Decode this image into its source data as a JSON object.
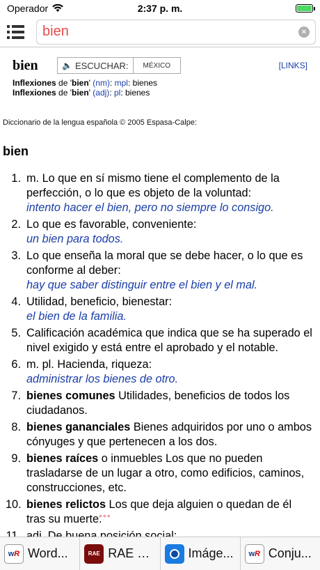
{
  "status": {
    "carrier": "Operador",
    "time": "2:37 p. m.",
    "battery_level": 1.0
  },
  "search": {
    "value": "bien",
    "clear_label": "×"
  },
  "entry": {
    "headword": "bien",
    "listen_label": "ESCUCHAR:",
    "region_label": "MÉXICO",
    "links_label": "[LINKS]",
    "inflections": [
      {
        "prefix": "Inflexiones",
        "mid": " de '",
        "word": "bien",
        "close": "' ",
        "pos": "(nm)",
        "sep": ": ",
        "form": "mpl",
        "rest": ": bienes"
      },
      {
        "prefix": "Inflexiones",
        "mid": " de '",
        "word": "bien",
        "close": "' ",
        "pos": "(adj)",
        "sep": ": ",
        "form": "pl",
        "rest": ": bienes"
      }
    ],
    "source": "Diccionario de la lengua española © 2005 Espasa-Calpe:",
    "def_title": "bien"
  },
  "definitions": [
    {
      "num": "1.",
      "bold": "",
      "text": "m. Lo que en sí mismo tiene el complemento de la perfección, o lo que es objeto de la voluntad:",
      "example": "intento hacer el bien, pero no siempre lo consigo."
    },
    {
      "num": "2.",
      "bold": "",
      "text": "Lo que es favorable, conveniente:",
      "example": "un bien para todos."
    },
    {
      "num": "3.",
      "bold": "",
      "text": "Lo que enseña la moral que se debe hacer, o lo que es conforme al deber:",
      "example": "hay que saber distinguir entre el bien y el mal."
    },
    {
      "num": "4.",
      "bold": "",
      "text": "Utilidad, beneficio, bienestar:",
      "example": "el bien de la familia."
    },
    {
      "num": "5.",
      "bold": "",
      "text": "Calificación académica que indica que se ha superado el nivel exigido y está entre el aprobado y el notable.",
      "example": ""
    },
    {
      "num": "6.",
      "bold": "",
      "text": "m. pl. Hacienda, riqueza:",
      "example": "administrar los bienes de otro."
    },
    {
      "num": "7.",
      "bold": "bienes comunes",
      "text": " Utilidades, beneficios de todos los ciudadanos.",
      "example": ""
    },
    {
      "num": "8.",
      "bold": "bienes gananciales",
      "text": " Bienes adquiridos por uno o ambos cónyuges y que pertenecen a los dos.",
      "example": ""
    },
    {
      "num": "9.",
      "bold": "bienes raíces",
      "text": " o inmuebles Los que no pueden trasladarse de un lugar a otro, como edificios, caminos, construcciones, etc.",
      "example": ""
    },
    {
      "num": "10.",
      "bold": "bienes relictos",
      "text": " Los que deja alguien o quedan de él tras su muerte.",
      "example": ""
    },
    {
      "num": "11.",
      "bold": "",
      "text": "adj. De buena posición social:",
      "example": ""
    }
  ],
  "loading_indicator": "•••",
  "tabs": [
    {
      "label": "Word...",
      "icon": "wordreference-icon"
    },
    {
      "label": "RAE B...",
      "icon": "rae-book-icon"
    },
    {
      "label": "Imáge...",
      "icon": "image-search-icon"
    },
    {
      "label": "Conju...",
      "icon": "wordreference-icon"
    }
  ],
  "colors": {
    "search_text": "#e54b4b",
    "link_blue": "#1a3ea8",
    "example_blue": "#1a3ea8"
  }
}
